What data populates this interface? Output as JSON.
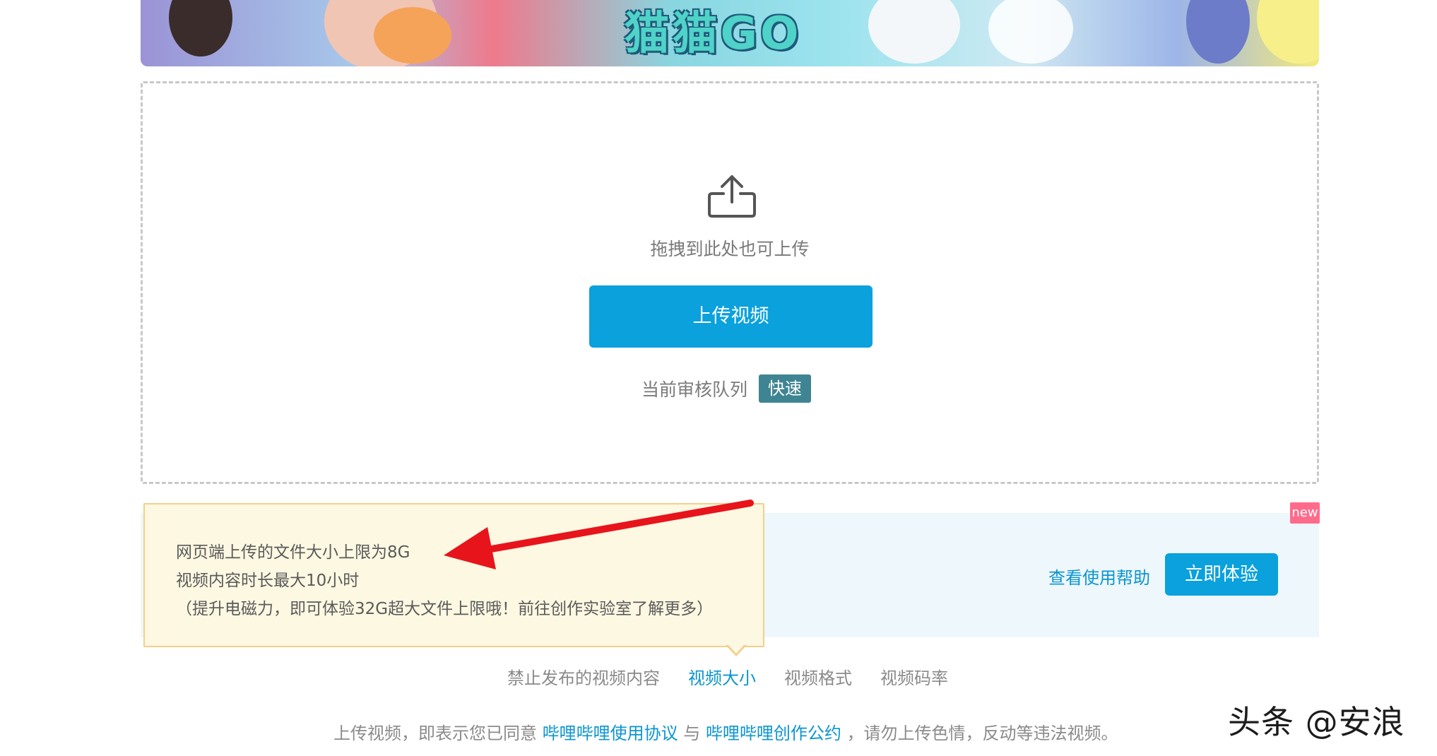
{
  "banner": {
    "title": "猫猫GO"
  },
  "dropzone": {
    "icon": "upload-icon",
    "hint": "拖拽到此处也可上传",
    "upload_button": "上传视频",
    "queue_label": "当前审核队列",
    "queue_status": "快速"
  },
  "lab": {
    "new_badge": "new",
    "help_link": "查看使用帮助",
    "try_button": "立即体验"
  },
  "tooltip": {
    "line1": "网页端上传的文件大小上限为8G",
    "line2": "视频内容时长最大10小时",
    "line3": "（提升电磁力，即可体验32G超大文件上限哦！前往创作实验室了解更多）"
  },
  "tabs": [
    {
      "label": "禁止发布的视频内容"
    },
    {
      "label": "视频大小"
    },
    {
      "label": "视频格式"
    },
    {
      "label": "视频码率"
    }
  ],
  "footer": {
    "prefix": "上传视频，即表示您已同意",
    "link1": "哔哩哔哩使用协议",
    "middle": "与",
    "link2": "哔哩哔哩创作公约",
    "suffix": "，请勿上传色情，反动等违法视频。"
  },
  "watermark": "头条 @安浪",
  "colors": {
    "accent": "#0aa1dd",
    "link": "#0b95d1",
    "queue_badge": "#3f8492",
    "new_badge": "#ff6b8b",
    "tooltip_bg": "#fdf8e2",
    "tooltip_border": "#f4cf8b",
    "annotation_arrow": "#e8141b"
  }
}
